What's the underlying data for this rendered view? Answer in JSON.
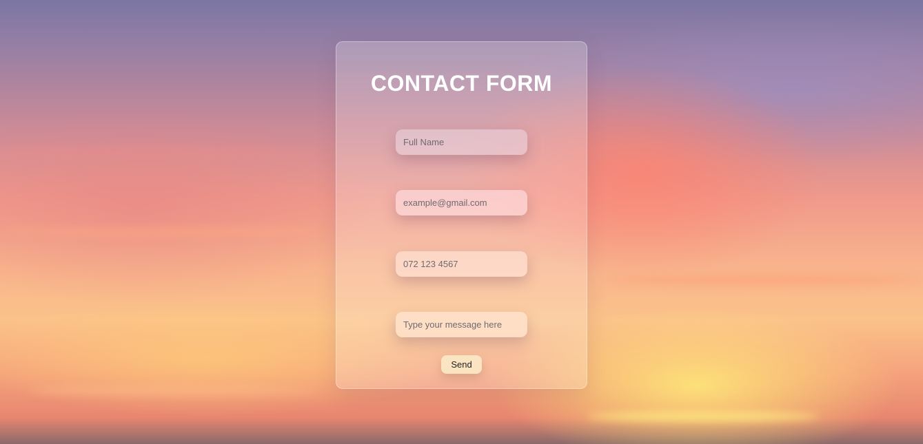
{
  "contact_form": {
    "title": "CONTACT FORM",
    "full_name_placeholder": "Full Name",
    "email_placeholder": "example@gmail.com",
    "phone_placeholder": "072 123 4567",
    "message_placeholder": "Type your message here",
    "send_label": "Send"
  }
}
